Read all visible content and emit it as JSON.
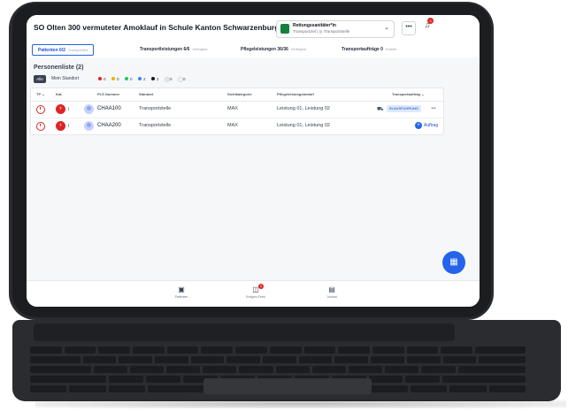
{
  "header": {
    "title": "SO Olten 300 vermuteter Amoklauf in Schule Kanton Schwarzenburg",
    "role_name": "Rettungssanitäter*in",
    "role_sub": "Transportziel | ◎ Transportstelle",
    "more": "•••",
    "notification_count": "3"
  },
  "tabs": [
    {
      "label": "Patienten 0/2",
      "sub": "Transportiert"
    },
    {
      "label": "Transportleistungen 6/6",
      "sub": "Verfügbar"
    },
    {
      "label": "Pflegeleistungen 36/36",
      "sub": "Verfügbar"
    },
    {
      "label": "Transportaufträge 0",
      "sub": "Erstellt"
    }
  ],
  "list": {
    "title": "Personenliste (2)",
    "filter_all": "Alle",
    "filter_own": "Mein Standort",
    "filters": [
      {
        "color": "#dc2626",
        "count": "0"
      },
      {
        "color": "#eab308",
        "count": "0"
      },
      {
        "color": "#22c55e",
        "count": "0"
      },
      {
        "color": "#3b82f6",
        "count": "2"
      },
      {
        "color": "#111827",
        "count": "2"
      },
      {
        "color": "#e5e7eb",
        "count": "0"
      },
      {
        "color": "#f3f4f6",
        "count": "0"
      }
    ]
  },
  "table": {
    "headers": {
      "tp": "TP ⌄",
      "kat": "Kat.",
      "pls": "PLS Nummer",
      "standort": "Standort",
      "sichtung": "Sichtkategorie",
      "pflege": "Pflegeleistungsbedarf",
      "auftrag": "Transportauftrag ⌄"
    },
    "rows": [
      {
        "cat": "I",
        "pls": "CHAA100",
        "standort": "Transportstelle",
        "sichtung": "MAX",
        "pflege": "Leistung 01, Leistung 02",
        "status": "IN AUSFÜHRUNG",
        "more": "•••"
      },
      {
        "cat": "I",
        "pls": "CHAA200",
        "standort": "Transportstelle",
        "sichtung": "MAX",
        "pflege": "Leistung 01, Leistung 02",
        "action": "Auftrag"
      }
    ]
  },
  "nav": [
    {
      "label": "Patienten",
      "icon": "briefcase-icon"
    },
    {
      "label": "Ereignis-Feed",
      "icon": "chat-icon",
      "badge": "3"
    },
    {
      "label": "Journal",
      "icon": "journal-icon"
    }
  ],
  "colors": {
    "accent": "#2563eb",
    "danger": "#dc2626",
    "success": "#15803d"
  }
}
